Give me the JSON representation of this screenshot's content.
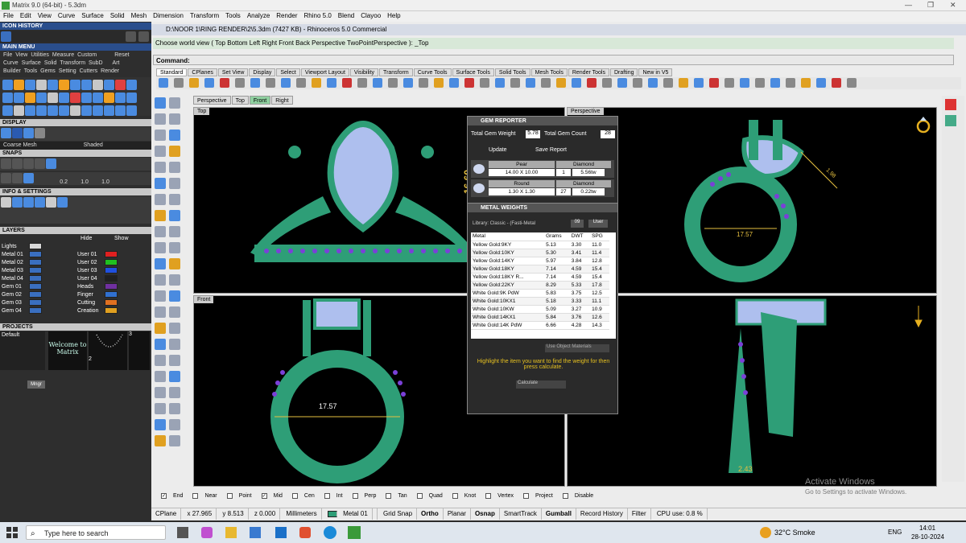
{
  "app": {
    "title": "Matrix 9.0 (64-bit) - 5.3dm",
    "min": "—",
    "max": "❐",
    "close": "✕"
  },
  "menu": [
    "File",
    "Edit",
    "View",
    "Curve",
    "Surface",
    "Solid",
    "Mesh",
    "Dimension",
    "Transform",
    "Tools",
    "Analyze",
    "Render",
    "Rhino 5.0",
    "Blend",
    "Clayoo",
    "Help"
  ],
  "left": {
    "icon_history": "ICON HISTORY",
    "main_menu": "MAIN MENU",
    "mm_row1": [
      "File",
      "View",
      "Utilities",
      "Measure",
      "Custom",
      "Reset"
    ],
    "mm_row2": [
      "Curve",
      "Surface",
      "Solid",
      "Transform",
      "SubD",
      "Art"
    ],
    "mm_row3": [
      "Builder",
      "Tools",
      "Gems",
      "Setting",
      "Cutters",
      "Render"
    ],
    "display": "DISPLAY",
    "display_modes": [
      "Coarse Mesh",
      "Shaded"
    ],
    "snaps": "SNAPS",
    "snap_vals": [
      "0.2",
      "1.0",
      "1.0"
    ],
    "info": "INFO & SETTINGS",
    "layers": "LAYERS",
    "layer_btns": [
      "Hide",
      "Show"
    ],
    "layer_rows": [
      [
        "Lights",
        "#d8d8d8",
        "",
        ""
      ],
      [
        "Metal 01",
        "#3a6fc0",
        "User 01",
        "#e02020"
      ],
      [
        "Metal 02",
        "#3a6fc0",
        "User 02",
        "#20c020"
      ],
      [
        "Metal 03",
        "#3a6fc0",
        "User 03",
        "#2050e0"
      ],
      [
        "Metal 04",
        "#3a6fc0",
        "User 04",
        "#202020"
      ],
      [
        "Gem 01",
        "#3a6fc0",
        "Heads",
        "#7030a0"
      ],
      [
        "Gem 02",
        "#3a6fc0",
        "Finger",
        "#3070d0"
      ],
      [
        "Gem 03",
        "#3a6fc0",
        "Cutting",
        "#e07020"
      ],
      [
        "Gem 04",
        "#3a6fc0",
        "Creation",
        "#e0a020"
      ]
    ],
    "projects": "PROJECTS",
    "proj_default": "Default",
    "proj_thumbs": [
      "Welcome to Matrix",
      "2",
      "3"
    ],
    "proj_btn": "Mngr"
  },
  "main": {
    "doc_title": "D:\\NOOR 1\\RING RENDER\\2\\5.3dm (7427 KB) - Rhinoceros 5.0 Commercial",
    "cmd_history": "Choose world view ( Top  Bottom  Left  Right  Front  Back  Perspective  TwoPointPerspective ): _Top",
    "cmd_label": "Command:",
    "tabs": [
      "Standard",
      "CPlanes",
      "Set View",
      "Display",
      "Select",
      "Viewport Layout",
      "Visibility",
      "Transform",
      "Curve Tools",
      "Surface Tools",
      "Solid Tools",
      "Mesh Tools",
      "Render Tools",
      "Drafting",
      "New in V5"
    ],
    "view_tabs": [
      "Perspective",
      "Top",
      "Front",
      "Right"
    ],
    "vp_labels": {
      "top": "Top",
      "perspective": "Perspective",
      "front": "Front",
      "right": "Right"
    },
    "dim_top": "16.60",
    "dim_persp_a": "17.57",
    "dim_persp_b": "1.98",
    "dim_front": "17.57",
    "dim_right": "2.43"
  },
  "gem": {
    "title": "GEM REPORTER",
    "total_weight_label": "Total Gem Weight",
    "total_weight": "5.78",
    "total_count_label": "Total Gem Count",
    "total_count": "28",
    "update": "Update",
    "save": "Save Report",
    "rows": [
      {
        "shape": "Pear",
        "size": "14.00 X 10.00",
        "type": "Diamond",
        "qty": "1",
        "tw": "5.56tw"
      },
      {
        "shape": "Round",
        "size": "1.30 X 1.30",
        "type": "Diamond",
        "qty": "27",
        "tw": "0.22tw"
      }
    ]
  },
  "metal": {
    "title": "METAL WEIGHTS",
    "library": "Library: Classic - (Fasti-Metal",
    "btn_a": "09",
    "btn_b": "User",
    "cols": [
      "Metal",
      "Grams",
      "DWT",
      "SPG"
    ],
    "rows": [
      [
        "Yellow Gold:9KY",
        "5.13",
        "3.30",
        "11.0"
      ],
      [
        "Yellow Gold:10KY",
        "5.30",
        "3.41",
        "11.4"
      ],
      [
        "Yellow Gold:14KY",
        "5.97",
        "3.84",
        "12.8"
      ],
      [
        "Yellow Gold:18KY",
        "7.14",
        "4.59",
        "15.4"
      ],
      [
        "Yellow Gold:18KY R...",
        "7.14",
        "4.59",
        "15.4"
      ],
      [
        "Yellow Gold:22KY",
        "8.29",
        "5.33",
        "17.8"
      ],
      [
        "White Gold:9K PdW",
        "5.83",
        "3.75",
        "12.5"
      ],
      [
        "White Gold:10KX1",
        "5.18",
        "3.33",
        "11.1"
      ],
      [
        "White Gold:10KW",
        "5.09",
        "3.27",
        "10.9"
      ],
      [
        "White Gold:14KX1",
        "5.84",
        "3.76",
        "12.6"
      ],
      [
        "White Gold:14K PdW",
        "6.66",
        "4.28",
        "14.3"
      ]
    ],
    "use_obj": "Use Object Materials",
    "hint": "Highlight the item you want to find the weight for then press calculate.",
    "calc": "Calculate"
  },
  "osnaps": [
    {
      "label": "End",
      "on": true
    },
    {
      "label": "Near",
      "on": false
    },
    {
      "label": "Point",
      "on": false
    },
    {
      "label": "Mid",
      "on": true
    },
    {
      "label": "Cen",
      "on": false
    },
    {
      "label": "Int",
      "on": false
    },
    {
      "label": "Perp",
      "on": false
    },
    {
      "label": "Tan",
      "on": false
    },
    {
      "label": "Quad",
      "on": false
    },
    {
      "label": "Knot",
      "on": false
    },
    {
      "label": "Vertex",
      "on": false
    },
    {
      "label": "Project",
      "on": false
    },
    {
      "label": "Disable",
      "on": false
    }
  ],
  "status": {
    "cplane": "CPlane",
    "x": "x 27.965",
    "y": "y 8.513",
    "z": "z 0.000",
    "units": "Millimeters",
    "layer": "Metal 01",
    "items": [
      "Grid Snap",
      "Ortho",
      "Planar",
      "Osnap",
      "SmartTrack",
      "Gumball",
      "Record History",
      "Filter"
    ],
    "bold": [
      "Ortho",
      "Osnap",
      "Gumball"
    ],
    "cpu": "CPU use: 0.8 %"
  },
  "watermark": {
    "line1": "Activate Windows",
    "line2": "Go to Settings to activate Windows."
  },
  "taskbar": {
    "search": "Type here to search",
    "weather": "32°C  Smoke",
    "lang": "ENG",
    "time": "14:01",
    "date": "28-10-2024"
  },
  "colors": {
    "ring": "#2e9e77",
    "gem": "#aebfee",
    "accent_purple": "#7a40d8",
    "dim": "#e6c040"
  }
}
